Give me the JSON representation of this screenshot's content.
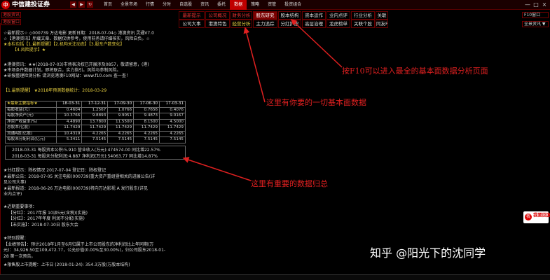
{
  "titlebar": {
    "app_title": "中信建投证券",
    "menu": [
      "首页",
      "全景市场",
      "行情",
      "分时",
      "自选股",
      "资讯",
      "委托",
      "数据",
      "策略",
      "资管",
      "投资组合"
    ],
    "active_menu_index": 7
  },
  "left_strip": [
    "港股资讯",
    "港股窗口"
  ],
  "tabs_row1": [
    "最新提示",
    "公司概况",
    "财务分析",
    "股东研究",
    "股本结构",
    "资本运作",
    "业内点评",
    "行业分析",
    "关联"
  ],
  "tabs_row2": [
    "公司大事",
    "港澳特色",
    "经营分析",
    "主力追踪",
    "分红扩股",
    "高层治理",
    "龙虎榜单",
    "关联个股",
    "同友F10"
  ],
  "right_strip": [
    "F10窗口",
    "全景资讯 ▼"
  ],
  "content": {
    "header_lines": [
      "☆最新提示☆ ◇000739 万达电影 更新日期：2018-07-04◇ 港澳资讯 灵通V7.0",
      "☆【港澳资讯】所载文章、数据仅供参考，使用前务请仔细核实，风险自负。☆",
      "★本栏包括【1.最新提醒】【2.机构关注动态】【3.股东户数变化】",
      "【4.风险提示】★"
    ],
    "notice_lines": [
      "★港澳资讯：★★(2018-07-03)市场表决权已开展涉及0857，敬请留意，(港)",
      "★市场条件数据计划，即将联合，实力指引。风险与参制风险。",
      "★研报整理检测分析 请浏览港澳F10网站：www.f10.com 查一查！"
    ],
    "section_title": "【1.最新提醒】 ★2018年预测数据统计：2018-03-29",
    "table": {
      "headers": [
        "★最新主要指标★",
        "18-03-31",
        "17-12-31",
        "17-09-30",
        "17-06-30",
        "17-03-31"
      ],
      "rows": [
        [
          "每股收益(元)",
          "0.4604",
          "1.2567",
          "1.0766",
          "0.7656",
          "0.4076"
        ],
        [
          "每股净资产(元)",
          "10.3766",
          "9.8893",
          "9.9051",
          "9.4873",
          "9.0167"
        ],
        [
          "净资产收益率(%)",
          "4.4890",
          "13.7800",
          "11.5500",
          "8.1500",
          "4.5000"
        ],
        [
          "总股本(亿股)",
          "11.7429",
          "11.7429",
          "11.7429",
          "11.7429",
          "11.7429"
        ],
        [
          "流通A股(亿股)",
          "10.4319",
          "4.2265",
          "4.2265",
          "4.2265",
          "4.2265"
        ],
        [
          "每股未分配利润(亿元)",
          "5.3411",
          "7.5145",
          "7.5145",
          "7.5145",
          "7.5145"
        ]
      ]
    },
    "summary_lines": [
      "2018-03-31  每股资本公积:5.910 营业收入(万元):474574.00 同比增22.57%",
      "2018-03-31  每股未分配利润:4.887 净利润(万元):54063.77  同比增14.87%"
    ],
    "block_lines": [
      "★分红提示：除权情况 2017-07-04 登记日：除权登记",
      "★最新公告：2018-07-05 关注电影(000739)重大资产重组暨相关的进展公告(详",
      "  见公司大事)",
      "★最新报道：2018-06-26 万达电影(000739)将向万达影视 A 发行股东(详见",
      "  业内点评)"
    ],
    "block2_lines": [
      "★近期重要事项：",
      "【分红】：2017年报 10派5元(含税)(实施)",
      "【分红】：2017年年度 利润不分配(实施)",
      "【未实施】：2018-07-10日 股东大会"
    ],
    "block3_lines": [
      "★特别提醒：",
      "【业绩预告】：预计2018年1月至6月归属于上市公司股东的净利润比上年同期(万",
      "  元)：34,926.50至109,472.77，公允价值(0.00%至30.00%)，归公司股东2018-01-",
      "  28 第一次预告。",
      "★限售股上市提醒：上市日 (2018-01-24): 354.3万股(万股本结构)"
    ]
  },
  "annotations": {
    "f10": "按F10可以进入最全的基本面数据分析页面",
    "basic": "这里有你要的一切基本面数据",
    "summary": "这里有重要的数据归总"
  },
  "watermark": "知乎 @阳光下的沈同学",
  "reply_badge": {
    "icon": "我",
    "text": "我要回复"
  },
  "colors": {
    "accent_red": "#e02020",
    "menu_active": "#c00000",
    "background": "#000000",
    "yellow_text": "#e8d040"
  }
}
